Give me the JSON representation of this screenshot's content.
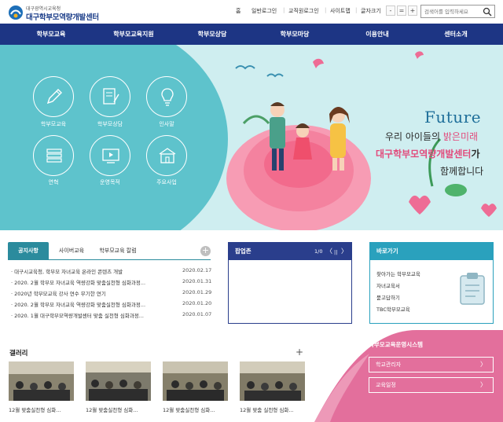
{
  "header": {
    "logo_sub": "대구광역시교육청",
    "logo_main": "대구학부모역량개발센터",
    "util_links": [
      "홈",
      "일반로그인",
      "교직원로그인",
      "사이트맵"
    ],
    "font_size_label": "글자크기",
    "font_size_buttons": [
      "-",
      "=",
      "+"
    ],
    "search_placeholder": "검색어를 입력하세요"
  },
  "nav": {
    "items": [
      "학부모교육",
      "학부모교육지원",
      "학부모상담",
      "학부모마당",
      "이용안내",
      "센터소개"
    ]
  },
  "hero": {
    "quick_links": [
      "학부모교육",
      "학부모상담",
      "인사말",
      "연혁",
      "운영목적",
      "주요사업"
    ],
    "future_word": "Future",
    "slogan_1a": "우리 아이들의 ",
    "slogan_1b": "밝은미래",
    "slogan_2a": "대구학부모역량개발센터",
    "slogan_2b": "가",
    "slogan_3": "함께합니다"
  },
  "notice": {
    "tabs": [
      "공지사항",
      "사이버교육",
      "학부모교육 칼럼"
    ],
    "more": "+",
    "rows": [
      {
        "title": "· 대구시교육청, 학부모 자녀교육 온라인 콘텐츠 개발",
        "date": "2020.02.17"
      },
      {
        "title": "· 2020. 2월 학부모 자녀교육 역량강화 맞춤실천형 심화과정...",
        "date": "2020.01.31"
      },
      {
        "title": "· 2020년 학부모교육 강사 연수 무기한 연기",
        "date": "2020.01.29"
      },
      {
        "title": "· 2020. 2월 학부모 자녀교육 역량강화 맞춤실천형 심화과정...",
        "date": "2020.01.20"
      },
      {
        "title": "· 2020. 1월 대구학부모역량개발센터 맞춤 실천형 심화과정...",
        "date": "2020.01.07"
      }
    ]
  },
  "popup": {
    "title": "팝업존",
    "page": "1/0",
    "prev": "〈",
    "pause": "||",
    "next": "〉"
  },
  "shortcut": {
    "title": "바로가기",
    "items": [
      "찾아가는 학부모교육",
      "자녀교육서",
      "묻고답하기",
      "TBC학부모교육"
    ]
  },
  "gallery": {
    "title": "갤러리",
    "more": "+",
    "captions": [
      "12월 맞춤실천형 심화...",
      "12월 맞춤실천형 심화...",
      "12월 맞춤실천형 심화...",
      "12월 맞춤 실천형 심화..."
    ]
  },
  "system": {
    "title": "학부모교육운영시스템",
    "buttons": [
      "학교관리자",
      "교육일정"
    ],
    "arrow": "〉"
  },
  "colors": {
    "nav_bg": "#1d3584",
    "hero_teal": "#5ec3cc",
    "hero_bg": "#cfeef0",
    "notice_tab": "#2b8b9d",
    "popup_head": "#2a3e8c",
    "shortcut_head": "#2aa1bd",
    "system_pink": "#e36f9c"
  }
}
